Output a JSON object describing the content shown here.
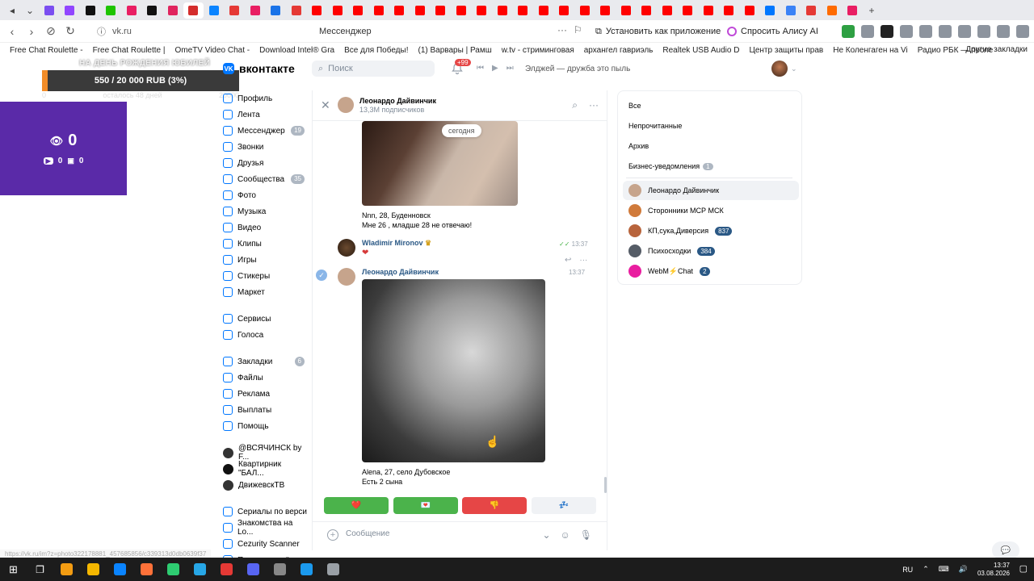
{
  "browser": {
    "url": "vk.ru",
    "page_title": "Мессенджер",
    "install_label": "Установить как приложение",
    "alice_label": "Спросить Алису AI",
    "bookmarks": [
      "Free Chat Roulette -",
      "Free Chat Roulette |",
      "OmeTV Video Chat -",
      "Download Intel® Gra",
      "Все для Победы!",
      "(1) Варвары | Рамш",
      "w.tv - стриминговая",
      "архангел гавриэль",
      "Realtek USB Audio D",
      "Центр защиты прав",
      "Не Коленгаген на Vi",
      "Радио РБК — после"
    ],
    "other_bookmarks": "Другие закладки",
    "tab_colors": [
      "#7b4ef0",
      "#9146ff",
      "#111111",
      "#1ec400",
      "#e91e63",
      "#111111",
      "#e0245e",
      "#d42d2d",
      "#0b84ff",
      "#e53935",
      "#e91e63",
      "#1a73e8",
      "#e53935",
      "#ff0000",
      "#ff0000",
      "#ff0000",
      "#ff0000",
      "#ff0000",
      "#ff0000",
      "#ff0000",
      "#ff0000",
      "#ff0000",
      "#ff0000",
      "#ff0000",
      "#ff0000",
      "#ff0000",
      "#ff0000",
      "#ff0000",
      "#ff0000",
      "#ff0000",
      "#ff0000",
      "#ff0000",
      "#ff0000",
      "#ff0000",
      "#ff0000",
      "#0077ff",
      "#3b82f6",
      "#e53935",
      "#ff6b00",
      "#e91e63"
    ]
  },
  "stream": {
    "birthday": "НА ДЕНЬ РОЖДЕНИЯ ЮБИЛЕЙ",
    "donation": "550 / 20 000 RUB (3%)",
    "donation_fraction": 0.03,
    "start": "0",
    "days_left": "осталось 48 дней",
    "end": "20000",
    "viewers": "0",
    "yt_count": "0",
    "twitch_count": "0"
  },
  "vk": {
    "logo": "вконтакте",
    "search_placeholder": "Поиск",
    "notif_count": "+99",
    "track": "Элджей — дружба это пыль",
    "nav": [
      {
        "label": "Профиль",
        "count": ""
      },
      {
        "label": "Лента",
        "count": ""
      },
      {
        "label": "Мессенджер",
        "count": "19"
      },
      {
        "label": "Звонки",
        "count": ""
      },
      {
        "label": "Друзья",
        "count": ""
      },
      {
        "label": "Сообщества",
        "count": "35"
      },
      {
        "label": "Фото",
        "count": ""
      },
      {
        "label": "Музыка",
        "count": ""
      },
      {
        "label": "Видео",
        "count": ""
      },
      {
        "label": "Клипы",
        "count": ""
      },
      {
        "label": "Игры",
        "count": ""
      },
      {
        "label": "Стикеры",
        "count": ""
      },
      {
        "label": "Маркет",
        "count": ""
      }
    ],
    "nav2": [
      "Сервисы",
      "Голоса"
    ],
    "nav3": [
      {
        "label": "Закладки",
        "count": "6"
      },
      {
        "label": "Файлы",
        "count": ""
      },
      {
        "label": "Реклама",
        "count": ""
      },
      {
        "label": "Выплаты",
        "count": ""
      },
      {
        "label": "Помощь",
        "count": ""
      }
    ],
    "communities": [
      "@ВСЯЧИНСК by F...",
      "Квартирник \"БАЛ...",
      "ДвижевскТВ"
    ],
    "apps": [
      "Сериалы по верси",
      "Знакомства на Lo...",
      "Cezurity Scanner",
      "Показать ещё"
    ]
  },
  "chat": {
    "name": "Леонардо Дайвинчик",
    "subscribers": "13,3М подписчиков",
    "today": "сегодня",
    "msg1_line1": "Nnn, 28, Буденновск",
    "msg1_line2": "Мне 26 , младше 28 не отвечаю!",
    "sender2": "Wladimir Mironov",
    "time2": "13:37",
    "sender3": "Леонардо Дайвинчик",
    "time3": "13:37",
    "msg3_line1": "Alena, 27, село Дубовское",
    "msg3_line2": "Есть 2 сына",
    "composer_placeholder": "Сообщение",
    "reactions": [
      {
        "emoji": "❤️",
        "color": "#4bb34b"
      },
      {
        "emoji": "💌",
        "color": "#4bb34b"
      },
      {
        "emoji": "👎",
        "color": "#e64646"
      },
      {
        "emoji": "💤",
        "color": "#f0f2f5"
      }
    ]
  },
  "dialogs": {
    "filters": [
      {
        "label": "Все",
        "count": ""
      },
      {
        "label": "Непрочитанные",
        "count": ""
      },
      {
        "label": "Архив",
        "count": ""
      },
      {
        "label": "Бизнес-уведомления",
        "count": "1"
      }
    ],
    "items": [
      {
        "name": "Леонардо Дайвинчик",
        "count": "",
        "color": "#c6a48c"
      },
      {
        "name": "Сторонники МСР МСК",
        "count": "",
        "color": "#d07a3a"
      },
      {
        "name": "КП,сука,Диверсия",
        "count": "837",
        "color": "#b8643c"
      },
      {
        "name": "Психосходки",
        "count": "384",
        "color": "#555c66"
      },
      {
        "name": "WebM⚡Chat",
        "count": "2",
        "color": "#e91ea0"
      }
    ]
  },
  "status_url": "https://vk.ru/im?z=photo322178881_457685856/c339313d0db0639f37",
  "taskbar": {
    "lang": "RU",
    "time": "13:37",
    "date": "03.08.2026",
    "icon_colors": [
      "#f39c12",
      "#f5b700",
      "#0a84ff",
      "#ff7139",
      "#2ecc71",
      "#27a7e7",
      "#e53935",
      "#5865f2",
      "#888888",
      "#1b9aee",
      "#9aa0a6"
    ]
  }
}
